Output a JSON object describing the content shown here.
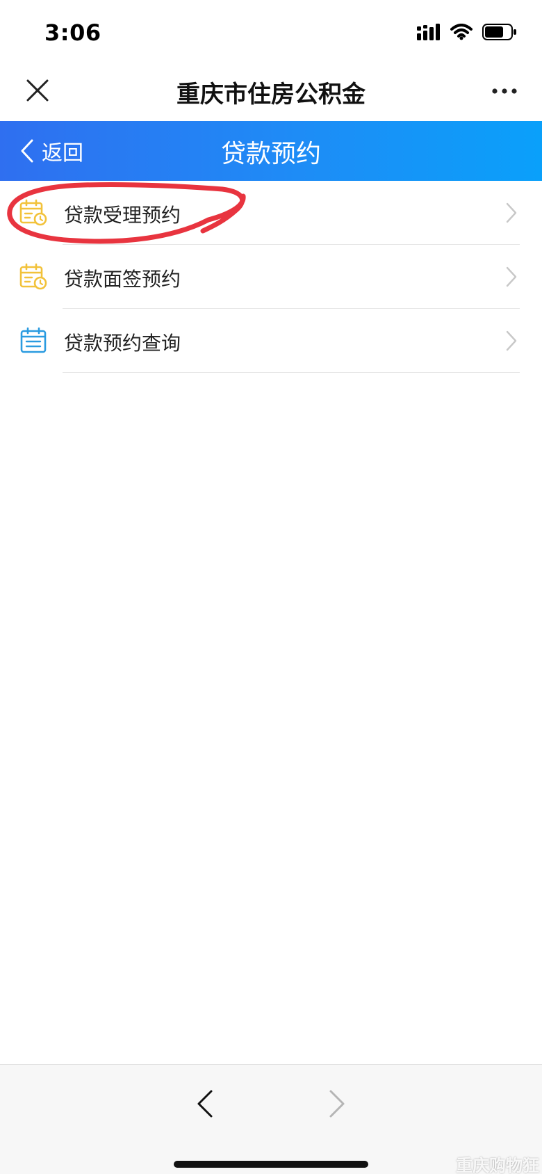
{
  "status_bar": {
    "time": "3:06"
  },
  "app_header": {
    "title": "重庆市住房公积金"
  },
  "nav_bar": {
    "back_label": "返回",
    "title": "贷款预约"
  },
  "menu": {
    "items": [
      {
        "label": "贷款受理预约",
        "icon": "calendar-clock-icon"
      },
      {
        "label": "贷款面签预约",
        "icon": "calendar-clock-icon"
      },
      {
        "label": "贷款预约查询",
        "icon": "calendar-list-icon"
      }
    ]
  },
  "watermark": {
    "text": "重庆购物狂"
  },
  "colors": {
    "nav_gradient_start": "#2f6ff0",
    "nav_gradient_end": "#0aa0fa",
    "icon_yellow": "#f2c23a",
    "icon_blue": "#2a9be0",
    "annotation_red": "#e8343f"
  }
}
